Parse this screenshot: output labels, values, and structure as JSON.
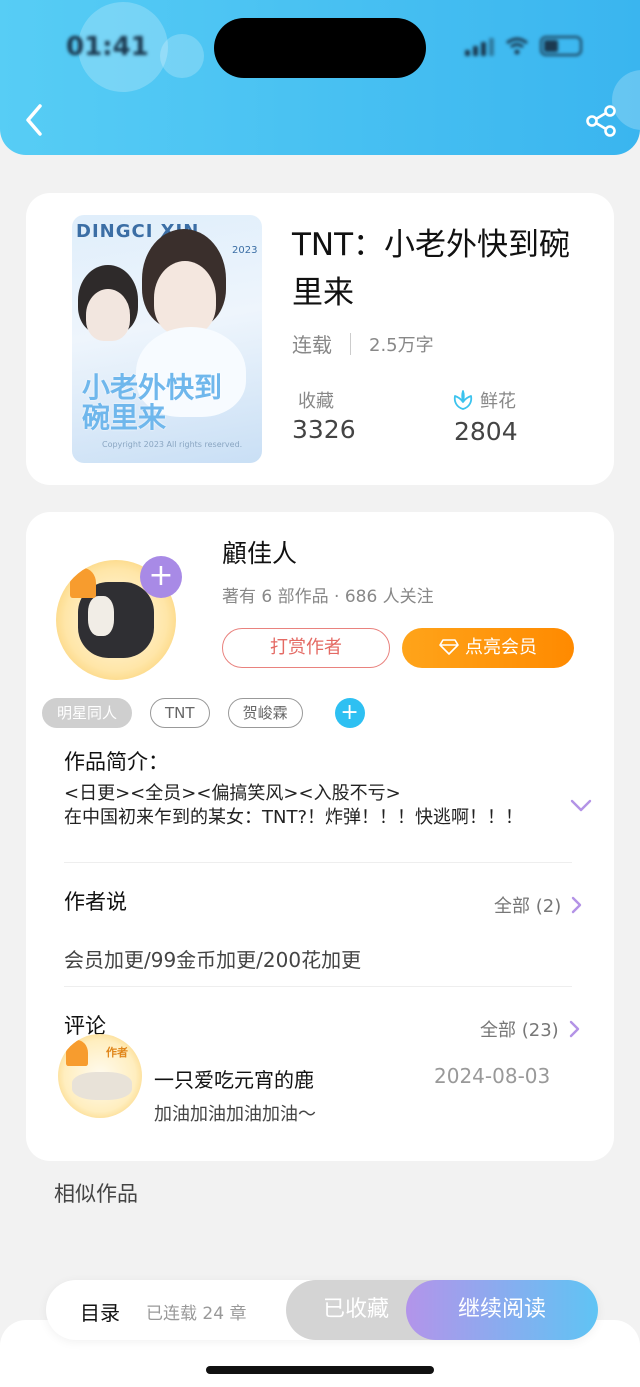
{
  "status": {
    "time": "01:41"
  },
  "book": {
    "title": "TNT：小老外快到碗里来",
    "status": "连载",
    "word_count": "2.5万字",
    "favorites_label": "收藏",
    "favorites_value": "3326",
    "flowers_label": "鲜花",
    "flowers_value": "2804",
    "cover": {
      "top_text": "DINGCI XIN",
      "title": "小老外快到碗里来",
      "year": "2023",
      "copyright": "Copyright 2023 All rights reserved."
    }
  },
  "author": {
    "name": "顧佳人",
    "info": "著有 6 部作品 · 686 人关注",
    "reward_label": "打赏作者",
    "vip_label": "点亮会员"
  },
  "tags": [
    "明星同人",
    "TNT",
    "贺峻霖"
  ],
  "intro": {
    "title": "作品简介：",
    "text": "<日更><全员><偏搞笑风><入股不亏>\n在中国初来乍到的某女：TNT?！炸弹！！！快逃啊！！！"
  },
  "author_says": {
    "title": "作者说",
    "all_label": "全部 (2)",
    "text": "会员加更/99金币加更/200花加更"
  },
  "comments": {
    "title": "评论",
    "all_label": "全部 (23)",
    "items": [
      {
        "user": "一只爱吃元宵的鹿",
        "text": "加油加油加油加油～",
        "date": "2024-08-03",
        "badge": "作者"
      }
    ]
  },
  "similar_title": "相似作品",
  "bottom_bar": {
    "toc_label": "目录",
    "chapter_count": "已连载 24 章",
    "favorited_label": "已收藏",
    "continue_label": "继续阅读"
  },
  "colors": {
    "header_accent": "#3ab5ef",
    "vip_orange": "#ff8a00",
    "reward_red": "#e46a64",
    "tag_add_blue": "#2ec0f2",
    "purple": "#a88ae6"
  }
}
